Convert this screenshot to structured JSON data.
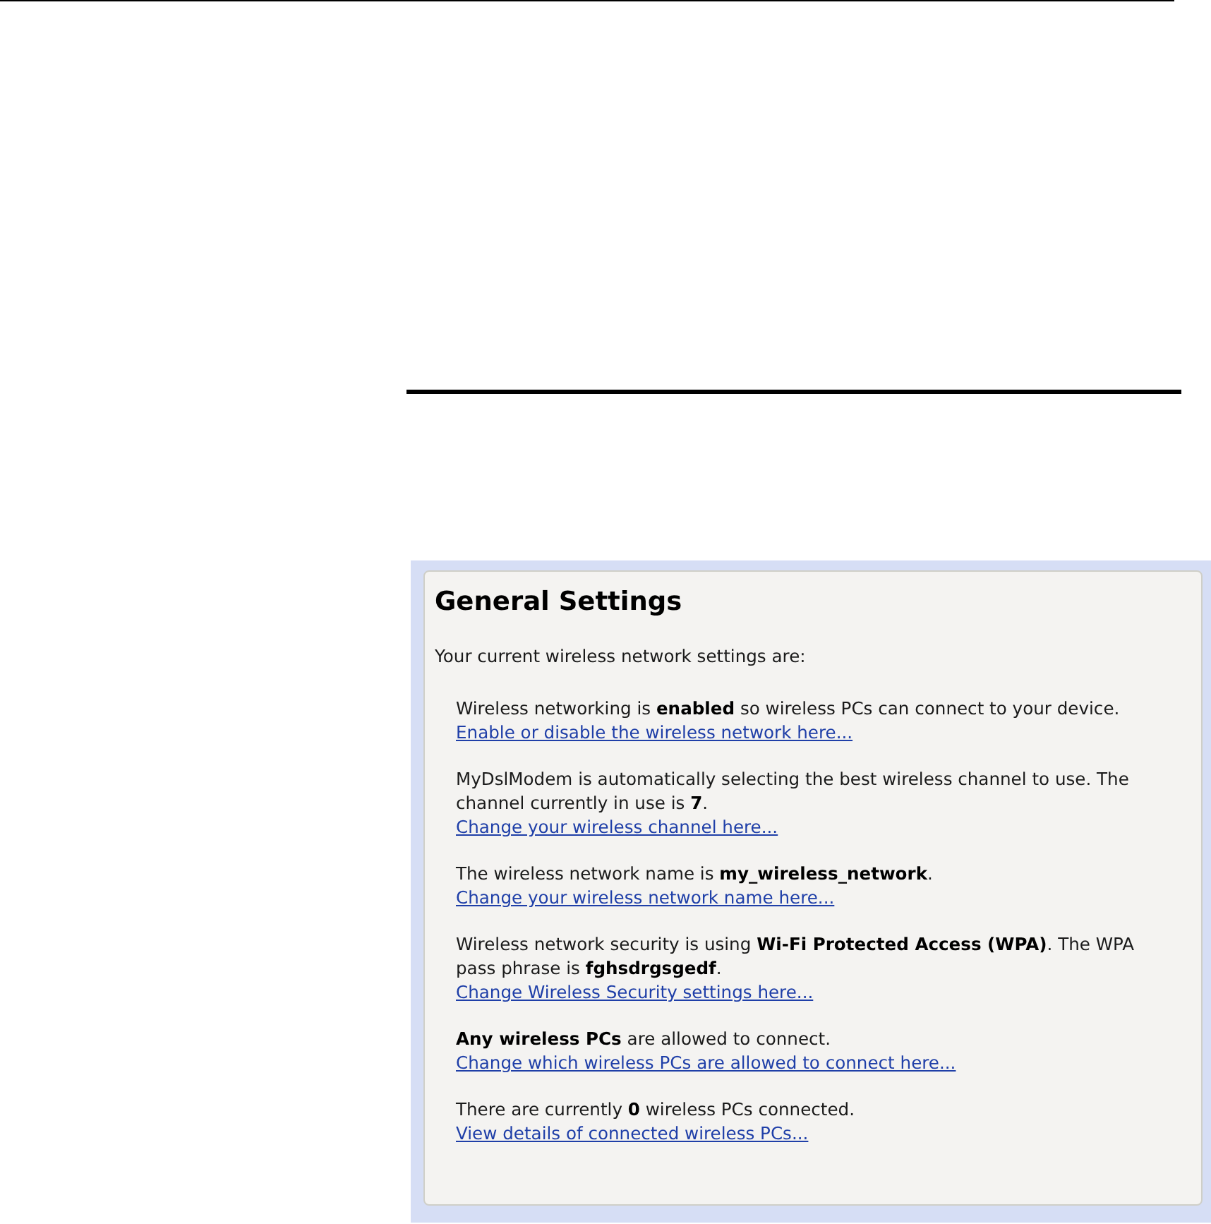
{
  "panel": {
    "title": "General Settings",
    "intro": "Your current wireless network settings are:",
    "items": [
      {
        "text": "Wireless networking is **enabled** so wireless PCs can connect to your device.",
        "link": "Enable or disable the wireless network here..."
      },
      {
        "text": "MyDslModem is automatically selecting the best wireless channel to use. The channel currently in use is **7**.",
        "link": "Change your wireless channel here..."
      },
      {
        "text": "The wireless network name is **my_wireless_network**.",
        "link": "Change your wireless network name here..."
      },
      {
        "text": "Wireless network security is using **Wi-Fi Protected Access (WPA)**. The WPA pass phrase is **fghsdrgsgedf**.",
        "link": "Change Wireless Security settings here..."
      },
      {
        "text": "**Any wireless PCs** are allowed to connect.",
        "link": "Change which wireless PCs are allowed to connect here..."
      },
      {
        "text": "There are currently **0** wireless PCs connected.",
        "link": "View details of connected wireless PCs..."
      }
    ]
  }
}
